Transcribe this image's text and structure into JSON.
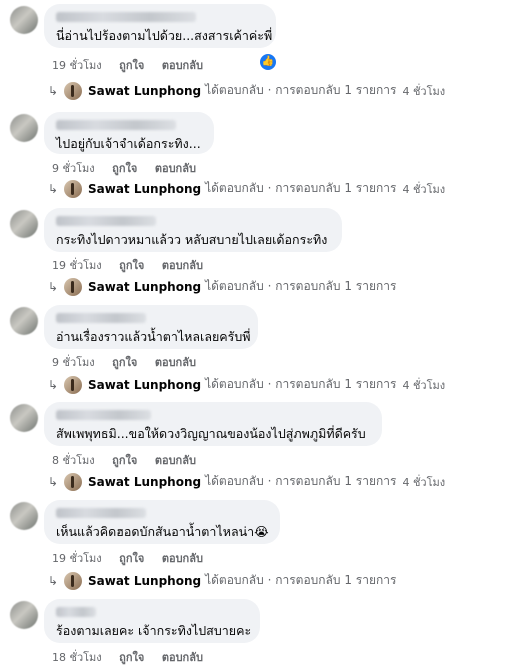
{
  "comments": [
    {
      "text": "นี่อ่านไปร้องตามไปด้วย...สงสารเค้าค่ะพี่",
      "time": "19 ชั่วโมง",
      "like": "ถูกใจ",
      "reply": "ตอบกลับ",
      "has_like_badge": true,
      "reply_row": {
        "name": "Sawat Lunphong",
        "action": "ได้ตอบกลับ · การตอบกลับ 1 รายการ",
        "time": "4 ชั่วโมง"
      }
    },
    {
      "text": "ไปอยู่กับเจ้าจำเด้อกระทิง...",
      "time": "9 ชั่วโมง",
      "like": "ถูกใจ",
      "reply": "ตอบกลับ",
      "reply_row": {
        "name": "Sawat Lunphong",
        "action": "ได้ตอบกลับ · การตอบกลับ 1 รายการ",
        "time": "4 ชั่วโมง"
      }
    },
    {
      "text": "กระทิงไปดาวหมาแล้วว หลับสบายไปเลยเด้อกระทิง",
      "time": "19 ชั่วโมง",
      "like": "ถูกใจ",
      "reply": "ตอบกลับ",
      "reply_row": {
        "name": "Sawat Lunphong",
        "action": "ได้ตอบกลับ · การตอบกลับ 1 รายการ",
        "time": ""
      }
    },
    {
      "text": "อ่านเรื่องราวแล้วน้ำตาไหลเลยครับพี่",
      "time": "9 ชั่วโมง",
      "like": "ถูกใจ",
      "reply": "ตอบกลับ",
      "reply_row": {
        "name": "Sawat Lunphong",
        "action": "ได้ตอบกลับ · การตอบกลับ 1 รายการ",
        "time": "4 ชั่วโมง"
      }
    },
    {
      "text": "สัพเพพุทธมิ...ขอให้ดวงวิญญาณของน้องไปสู่ภพภูมิที่ดีครับ",
      "time": "8 ชั่วโมง",
      "like": "ถูกใจ",
      "reply": "ตอบกลับ",
      "reply_row": {
        "name": "Sawat Lunphong",
        "action": "ได้ตอบกลับ · การตอบกลับ 1 รายการ",
        "time": "4 ชั่วโมง"
      }
    },
    {
      "text": "เห็นแล้วคิดฮอดบักสันอาน้ำตาไหลน่า😭",
      "time": "19 ชั่วโมง",
      "like": "ถูกใจ",
      "reply": "ตอบกลับ",
      "reply_row": {
        "name": "Sawat Lunphong",
        "action": "ได้ตอบกลับ · การตอบกลับ 1 รายการ",
        "time": ""
      }
    },
    {
      "text": "ร้องตามเลยคะ เจ้ากระทิงไปสบายคะ",
      "time": "18 ชั่วโมง",
      "like": "ถูกใจ",
      "reply": "ตอบกลับ"
    }
  ],
  "icons": {
    "like_badge": "thumbs-up-icon",
    "reply_arrow": "reply-arrow-icon"
  },
  "colors": {
    "bubble": "#f0f2f5",
    "meta": "#65676b",
    "like_blue": "#1877f2"
  }
}
